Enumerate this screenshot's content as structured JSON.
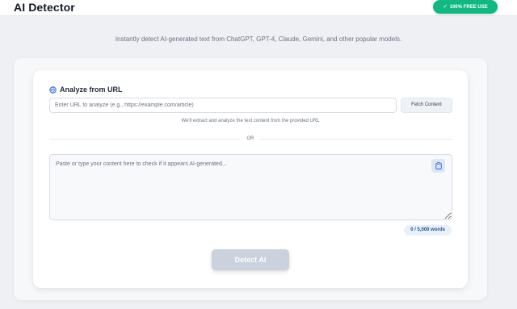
{
  "header": {
    "title": "AI Detector",
    "badge_check": "✓",
    "badge_label": "100% FREE USE"
  },
  "subtitle": "Instantly detect AI-generated text from ChatGPT, GPT-4, Claude, Gemini, and other popular models.",
  "url_section": {
    "icon": "globe-icon",
    "title": "Analyze from URL",
    "input_value": "",
    "input_placeholder": "Enter URL to analyze (e.g., https://example.com/article)",
    "fetch_label": "Fetch Content",
    "helper": "We'll extract and analyze the text content from the provided URL"
  },
  "divider_label": "OR",
  "text_section": {
    "textarea_value": "",
    "textarea_placeholder": "Paste or type your content here to check if it appears AI-generated...",
    "clipboard_icon": "clipboard-icon",
    "word_count": "0 / 5,000 words"
  },
  "detect_label": "Detect AI",
  "colors": {
    "accent_green": "#10b981",
    "globe_blue": "#2563eb",
    "detect_disabled": "#c9d2dd",
    "count_text": "#1e4e8c"
  }
}
